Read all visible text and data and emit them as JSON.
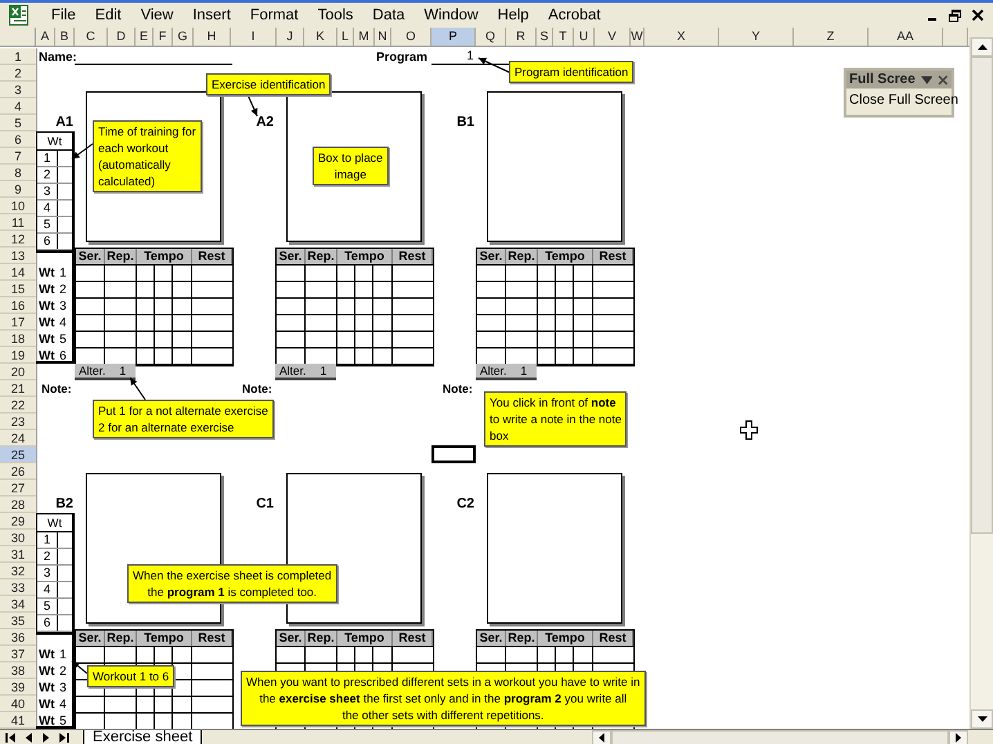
{
  "menu": [
    "File",
    "Edit",
    "View",
    "Insert",
    "Format",
    "Tools",
    "Data",
    "Window",
    "Help",
    "Acrobat"
  ],
  "columns": [
    {
      "label": "A",
      "selected": false
    },
    {
      "label": "B",
      "selected": false
    },
    {
      "label": "C",
      "selected": false
    },
    {
      "label": "D",
      "selected": false
    },
    {
      "label": "E",
      "selected": false
    },
    {
      "label": "F",
      "selected": false
    },
    {
      "label": "G",
      "selected": false
    },
    {
      "label": "H",
      "selected": false
    },
    {
      "label": "I",
      "selected": false
    },
    {
      "label": "J",
      "selected": false
    },
    {
      "label": "K",
      "selected": false
    },
    {
      "label": "L",
      "selected": false
    },
    {
      "label": "M",
      "selected": false
    },
    {
      "label": "N",
      "selected": false
    },
    {
      "label": "O",
      "selected": false
    },
    {
      "label": "P",
      "selected": true
    },
    {
      "label": "Q",
      "selected": false
    },
    {
      "label": "R",
      "selected": false
    },
    {
      "label": "S",
      "selected": false
    },
    {
      "label": "T",
      "selected": false
    },
    {
      "label": "U",
      "selected": false
    },
    {
      "label": "V",
      "selected": false
    },
    {
      "label": "W",
      "selected": false
    },
    {
      "label": "X",
      "selected": false
    },
    {
      "label": "Y",
      "selected": false
    },
    {
      "label": "Z",
      "selected": false
    },
    {
      "label": "AA",
      "selected": false
    }
  ],
  "rows": [
    {
      "label": "1",
      "selected": false
    },
    {
      "label": "2",
      "selected": false
    },
    {
      "label": "3",
      "selected": false
    },
    {
      "label": "4",
      "selected": false
    },
    {
      "label": "5",
      "selected": false
    },
    {
      "label": "6",
      "selected": false
    },
    {
      "label": "7",
      "selected": false
    },
    {
      "label": "8",
      "selected": false
    },
    {
      "label": "9",
      "selected": false
    },
    {
      "label": "10",
      "selected": false
    },
    {
      "label": "11",
      "selected": false
    },
    {
      "label": "12",
      "selected": false
    },
    {
      "label": "13",
      "selected": false
    },
    {
      "label": "14",
      "selected": false
    },
    {
      "label": "15",
      "selected": false
    },
    {
      "label": "16",
      "selected": false
    },
    {
      "label": "17",
      "selected": false
    },
    {
      "label": "18",
      "selected": false
    },
    {
      "label": "19",
      "selected": false
    },
    {
      "label": "20",
      "selected": false
    },
    {
      "label": "21",
      "selected": false
    },
    {
      "label": "22",
      "selected": false
    },
    {
      "label": "23",
      "selected": false
    },
    {
      "label": "24",
      "selected": false
    },
    {
      "label": "25",
      "selected": true
    },
    {
      "label": "26",
      "selected": false
    },
    {
      "label": "27",
      "selected": false
    },
    {
      "label": "28",
      "selected": false
    },
    {
      "label": "29",
      "selected": false
    },
    {
      "label": "30",
      "selected": false
    },
    {
      "label": "31",
      "selected": false
    },
    {
      "label": "32",
      "selected": false
    },
    {
      "label": "33",
      "selected": false
    },
    {
      "label": "34",
      "selected": false
    },
    {
      "label": "35",
      "selected": false
    },
    {
      "label": "36",
      "selected": false
    },
    {
      "label": "37",
      "selected": false
    },
    {
      "label": "38",
      "selected": false
    },
    {
      "label": "39",
      "selected": false
    },
    {
      "label": "40",
      "selected": false
    },
    {
      "label": "41",
      "selected": false
    }
  ],
  "header": {
    "name_label": "Name:",
    "program_label": "Program",
    "program_value": "1"
  },
  "bands": [
    {
      "workout_table": {
        "header": "Wt",
        "numbers": [
          "1",
          "2",
          "3",
          "4",
          "5",
          "6"
        ]
      },
      "row_labels": [
        {
          "label": "Wt",
          "number": "1"
        },
        {
          "label": "Wt",
          "number": "2"
        },
        {
          "label": "Wt",
          "number": "3"
        },
        {
          "label": "Wt",
          "number": "4"
        },
        {
          "label": "Wt",
          "number": "5"
        },
        {
          "label": "Wt",
          "number": "6"
        }
      ],
      "exercises": [
        {
          "label": "A1",
          "columns": [
            "Ser.",
            "Rep.",
            "Tempo",
            "Rest"
          ],
          "alter_label": "Alter.",
          "alter_value": "1",
          "note_label": "Note:"
        },
        {
          "label": "A2",
          "columns": [
            "Ser.",
            "Rep.",
            "Tempo",
            "Rest"
          ],
          "alter_label": "Alter.",
          "alter_value": "1",
          "note_label": "Note:"
        },
        {
          "label": "B1",
          "columns": [
            "Ser.",
            "Rep.",
            "Tempo",
            "Rest"
          ],
          "alter_label": "Alter.",
          "alter_value": "1",
          "note_label": "Note:"
        }
      ]
    },
    {
      "workout_table": {
        "header": "Wt",
        "numbers": [
          "1",
          "2",
          "3",
          "4",
          "5",
          "6"
        ]
      },
      "row_labels": [
        {
          "label": "Wt",
          "number": "1"
        },
        {
          "label": "Wt",
          "number": "2"
        },
        {
          "label": "Wt",
          "number": "3"
        },
        {
          "label": "Wt",
          "number": "4"
        },
        {
          "label": "Wt",
          "number": "5"
        }
      ],
      "exercises": [
        {
          "label": "B2",
          "columns": [
            "Ser.",
            "Rep.",
            "Tempo",
            "Rest"
          ]
        },
        {
          "label": "C1",
          "columns": [
            "Ser.",
            "Rep.",
            "Tempo",
            "Rest"
          ]
        },
        {
          "label": "C2",
          "columns": [
            "Ser.",
            "Rep.",
            "Tempo",
            "Rest"
          ]
        }
      ]
    }
  ],
  "comments": [
    {
      "lines": [
        "Exercise identification"
      ]
    },
    {
      "lines": [
        "Program identification"
      ]
    },
    {
      "lines": [
        "Time of training for",
        "each workout",
        "(automatically",
        "calculated)"
      ]
    },
    {
      "lines": [
        "Box to place",
        "image"
      ]
    },
    {
      "lines": [
        "Put 1 for a not alternate exercise",
        "2 for an alternate exercise"
      ]
    },
    {
      "lines": [
        "You click in front of **note**",
        "to write a note in the note",
        "box"
      ]
    },
    {
      "lines": [
        "When the exercise sheet is completed",
        "the **program 1** is completed too."
      ]
    },
    {
      "lines": [
        "Workout 1 to 6"
      ]
    },
    {
      "lines": [
        "When you want to prescribed different sets in a workout you have to write in",
        "the **exercise sheet** the first set only and in the **program 2** you write all",
        "the other sets with different repetitions."
      ]
    }
  ],
  "full_screen": {
    "title": "Full Scree",
    "button": "Close Full Screen"
  },
  "sheet_tabs": [
    {
      "label": "Exercise sheet",
      "selected": true
    }
  ]
}
